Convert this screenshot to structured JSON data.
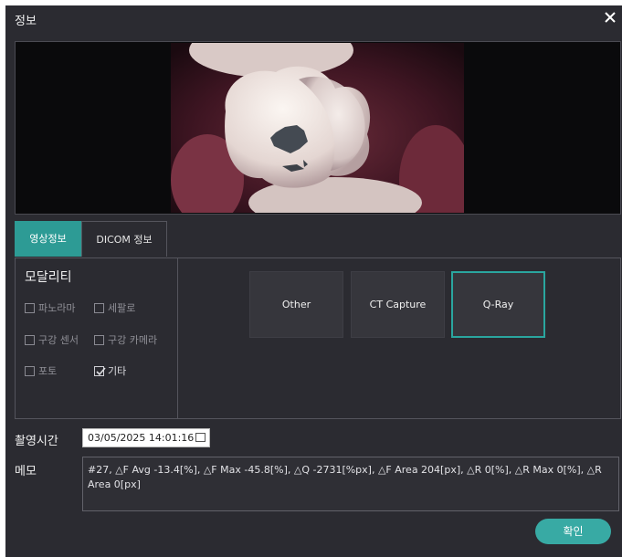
{
  "window": {
    "title": "정보"
  },
  "tabs": [
    {
      "label": "영상정보",
      "active": true
    },
    {
      "label": "DICOM 정보",
      "active": false
    }
  ],
  "modality": {
    "title": "모달리티",
    "checkboxes": [
      {
        "label": "파노라마",
        "checked": false
      },
      {
        "label": "세팔로",
        "checked": false
      },
      {
        "label": "구강 센서",
        "checked": false
      },
      {
        "label": "구강 카메라",
        "checked": false
      },
      {
        "label": "포토",
        "checked": false
      },
      {
        "label": "기타",
        "checked": true
      }
    ],
    "options": [
      {
        "label": "Other",
        "selected": false
      },
      {
        "label": "CT Capture",
        "selected": false
      },
      {
        "label": "Q-Ray",
        "selected": true
      }
    ]
  },
  "capture_time": {
    "label": "촬영시간",
    "value": "03/05/2025 14:01:16"
  },
  "memo": {
    "label": "메모",
    "value": "#27, △F Avg -13.4[%], △F Max -45.8[%], △Q -2731[%px], △F Area 204[px], △R 0[%], △R Max 0[%], △R Area 0[px]"
  },
  "buttons": {
    "ok": "확인"
  },
  "colors": {
    "accent": "#2d9b95",
    "background": "#2b2b31"
  }
}
